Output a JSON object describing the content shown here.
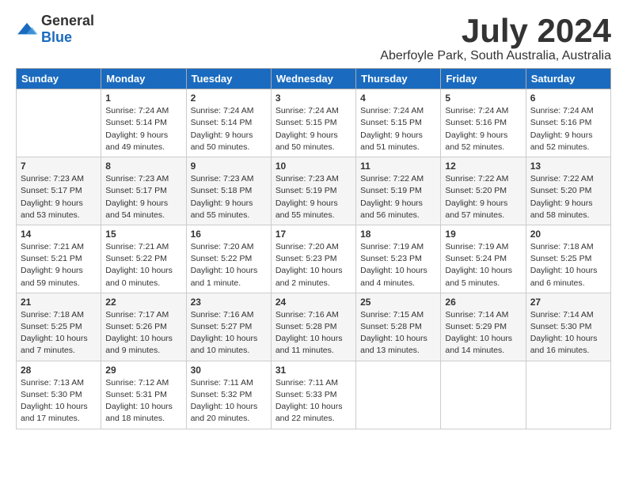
{
  "header": {
    "logo_general": "General",
    "logo_blue": "Blue",
    "month_title": "July 2024",
    "location": "Aberfoyle Park, South Australia, Australia"
  },
  "calendar": {
    "days_of_week": [
      "Sunday",
      "Monday",
      "Tuesday",
      "Wednesday",
      "Thursday",
      "Friday",
      "Saturday"
    ],
    "weeks": [
      [
        {
          "day": "",
          "info": ""
        },
        {
          "day": "1",
          "info": "Sunrise: 7:24 AM\nSunset: 5:14 PM\nDaylight: 9 hours\nand 49 minutes."
        },
        {
          "day": "2",
          "info": "Sunrise: 7:24 AM\nSunset: 5:14 PM\nDaylight: 9 hours\nand 50 minutes."
        },
        {
          "day": "3",
          "info": "Sunrise: 7:24 AM\nSunset: 5:15 PM\nDaylight: 9 hours\nand 50 minutes."
        },
        {
          "day": "4",
          "info": "Sunrise: 7:24 AM\nSunset: 5:15 PM\nDaylight: 9 hours\nand 51 minutes."
        },
        {
          "day": "5",
          "info": "Sunrise: 7:24 AM\nSunset: 5:16 PM\nDaylight: 9 hours\nand 52 minutes."
        },
        {
          "day": "6",
          "info": "Sunrise: 7:24 AM\nSunset: 5:16 PM\nDaylight: 9 hours\nand 52 minutes."
        }
      ],
      [
        {
          "day": "7",
          "info": "Sunrise: 7:23 AM\nSunset: 5:17 PM\nDaylight: 9 hours\nand 53 minutes."
        },
        {
          "day": "8",
          "info": "Sunrise: 7:23 AM\nSunset: 5:17 PM\nDaylight: 9 hours\nand 54 minutes."
        },
        {
          "day": "9",
          "info": "Sunrise: 7:23 AM\nSunset: 5:18 PM\nDaylight: 9 hours\nand 55 minutes."
        },
        {
          "day": "10",
          "info": "Sunrise: 7:23 AM\nSunset: 5:19 PM\nDaylight: 9 hours\nand 55 minutes."
        },
        {
          "day": "11",
          "info": "Sunrise: 7:22 AM\nSunset: 5:19 PM\nDaylight: 9 hours\nand 56 minutes."
        },
        {
          "day": "12",
          "info": "Sunrise: 7:22 AM\nSunset: 5:20 PM\nDaylight: 9 hours\nand 57 minutes."
        },
        {
          "day": "13",
          "info": "Sunrise: 7:22 AM\nSunset: 5:20 PM\nDaylight: 9 hours\nand 58 minutes."
        }
      ],
      [
        {
          "day": "14",
          "info": "Sunrise: 7:21 AM\nSunset: 5:21 PM\nDaylight: 9 hours\nand 59 minutes."
        },
        {
          "day": "15",
          "info": "Sunrise: 7:21 AM\nSunset: 5:22 PM\nDaylight: 10 hours\nand 0 minutes."
        },
        {
          "day": "16",
          "info": "Sunrise: 7:20 AM\nSunset: 5:22 PM\nDaylight: 10 hours\nand 1 minute."
        },
        {
          "day": "17",
          "info": "Sunrise: 7:20 AM\nSunset: 5:23 PM\nDaylight: 10 hours\nand 2 minutes."
        },
        {
          "day": "18",
          "info": "Sunrise: 7:19 AM\nSunset: 5:23 PM\nDaylight: 10 hours\nand 4 minutes."
        },
        {
          "day": "19",
          "info": "Sunrise: 7:19 AM\nSunset: 5:24 PM\nDaylight: 10 hours\nand 5 minutes."
        },
        {
          "day": "20",
          "info": "Sunrise: 7:18 AM\nSunset: 5:25 PM\nDaylight: 10 hours\nand 6 minutes."
        }
      ],
      [
        {
          "day": "21",
          "info": "Sunrise: 7:18 AM\nSunset: 5:25 PM\nDaylight: 10 hours\nand 7 minutes."
        },
        {
          "day": "22",
          "info": "Sunrise: 7:17 AM\nSunset: 5:26 PM\nDaylight: 10 hours\nand 9 minutes."
        },
        {
          "day": "23",
          "info": "Sunrise: 7:16 AM\nSunset: 5:27 PM\nDaylight: 10 hours\nand 10 minutes."
        },
        {
          "day": "24",
          "info": "Sunrise: 7:16 AM\nSunset: 5:28 PM\nDaylight: 10 hours\nand 11 minutes."
        },
        {
          "day": "25",
          "info": "Sunrise: 7:15 AM\nSunset: 5:28 PM\nDaylight: 10 hours\nand 13 minutes."
        },
        {
          "day": "26",
          "info": "Sunrise: 7:14 AM\nSunset: 5:29 PM\nDaylight: 10 hours\nand 14 minutes."
        },
        {
          "day": "27",
          "info": "Sunrise: 7:14 AM\nSunset: 5:30 PM\nDaylight: 10 hours\nand 16 minutes."
        }
      ],
      [
        {
          "day": "28",
          "info": "Sunrise: 7:13 AM\nSunset: 5:30 PM\nDaylight: 10 hours\nand 17 minutes."
        },
        {
          "day": "29",
          "info": "Sunrise: 7:12 AM\nSunset: 5:31 PM\nDaylight: 10 hours\nand 18 minutes."
        },
        {
          "day": "30",
          "info": "Sunrise: 7:11 AM\nSunset: 5:32 PM\nDaylight: 10 hours\nand 20 minutes."
        },
        {
          "day": "31",
          "info": "Sunrise: 7:11 AM\nSunset: 5:33 PM\nDaylight: 10 hours\nand 22 minutes."
        },
        {
          "day": "",
          "info": ""
        },
        {
          "day": "",
          "info": ""
        },
        {
          "day": "",
          "info": ""
        }
      ]
    ]
  }
}
